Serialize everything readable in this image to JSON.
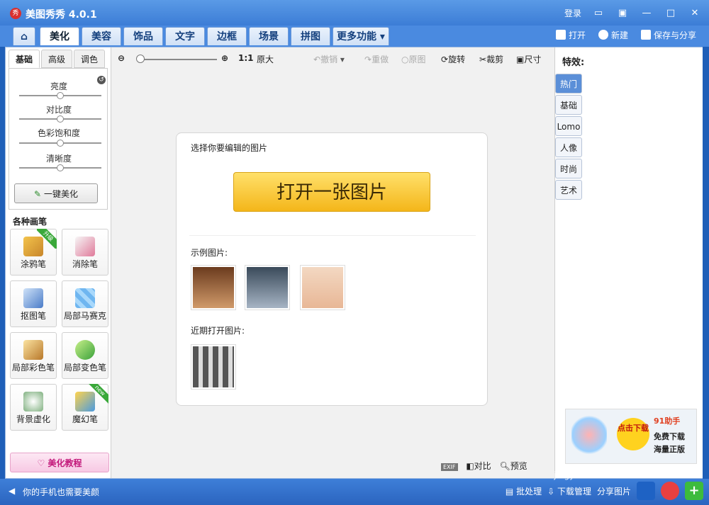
{
  "window": {
    "title": "美图秀秀 4.0.1",
    "logo_text": "秀",
    "login_label": "登录"
  },
  "tabs": [
    "美化",
    "美容",
    "饰品",
    "文字",
    "边框",
    "场景",
    "拼图",
    "更多功能"
  ],
  "top_actions": {
    "open": "打开",
    "new": "新建",
    "save_share": "保存与分享"
  },
  "left": {
    "subtabs": [
      "基础",
      "高级",
      "调色"
    ],
    "sliders": [
      {
        "label": "亮度",
        "value": 0.5
      },
      {
        "label": "对比度",
        "value": 0.5
      },
      {
        "label": "色彩饱和度",
        "value": 0.5
      },
      {
        "label": "清晰度",
        "value": 0.5
      }
    ],
    "one_key_beautify": "一键美化",
    "brushes_title": "各种画笔",
    "tools": [
      {
        "label": "涂鸦笔",
        "badge": "升级"
      },
      {
        "label": "消除笔",
        "badge": ""
      },
      {
        "label": "抠图笔",
        "badge": ""
      },
      {
        "label": "局部马赛克",
        "badge": ""
      },
      {
        "label": "局部彩色笔",
        "badge": ""
      },
      {
        "label": "局部变色笔",
        "badge": ""
      },
      {
        "label": "背景虚化",
        "badge": ""
      },
      {
        "label": "魔幻笔",
        "badge": "new"
      }
    ],
    "tutorial": "美化教程"
  },
  "toolbar": {
    "zoom_ratio": "1:1",
    "original_size": "原大",
    "undo": "撤销",
    "redo": "重做",
    "original": "原图",
    "rotate": "旋转",
    "crop": "裁剪",
    "size": "尺寸"
  },
  "canvas": {
    "prompt": "选择你要编辑的图片",
    "open_image": "打开一张图片",
    "examples_label": "示例图片:",
    "recent_label": "近期打开图片:"
  },
  "bottom_tools": {
    "exif": "EXIF",
    "compare": "对比",
    "preview": "预览"
  },
  "right": {
    "title": "特效:",
    "fx_tabs": [
      "热门",
      "基础",
      "Lomo",
      "人像",
      "时尚",
      "艺术"
    ],
    "ad_brand": "91助手",
    "ad_click": "点击下载",
    "ad_text1": "免费下载",
    "ad_text2": "海量正版"
  },
  "status": {
    "message": "你的手机也需要美颜",
    "batch": "批处理",
    "download_manage": "下载管理",
    "share_pic": "分享图片"
  },
  "watermark": "jingyan.baidu.com",
  "colors": {
    "accent_blue": "#3a7bd5",
    "open_btn": "#f4b61a",
    "fx_active": "#5b8fd8"
  }
}
